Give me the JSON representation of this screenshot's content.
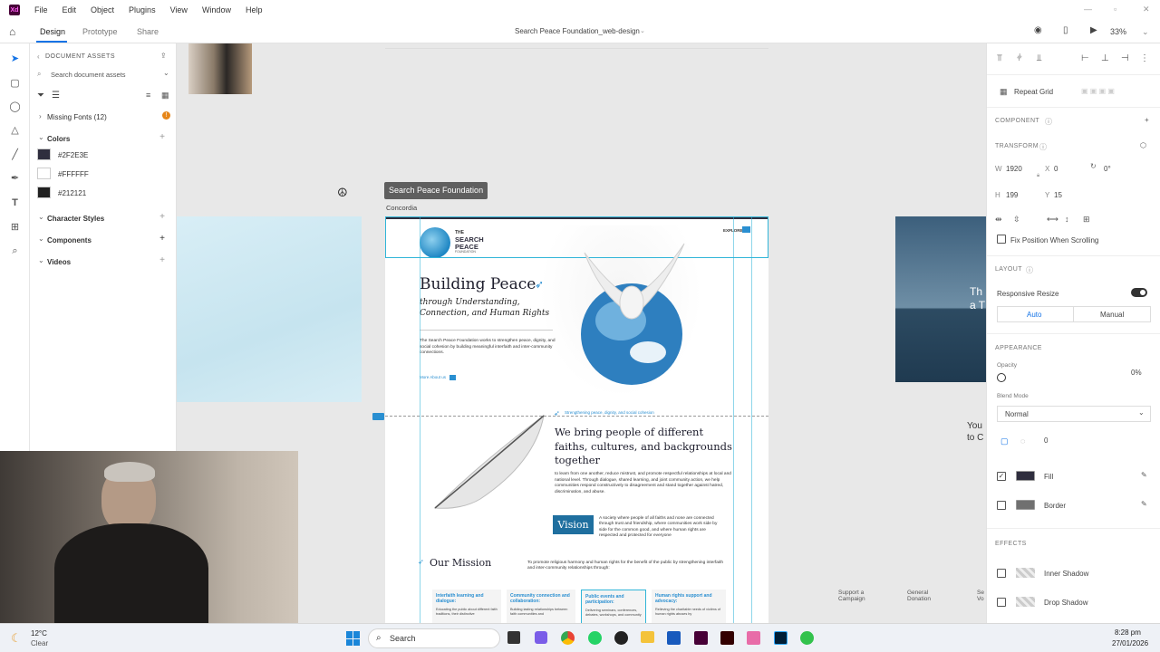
{
  "menubar": {
    "items": [
      "File",
      "Edit",
      "Object",
      "Plugins",
      "View",
      "Window",
      "Help"
    ]
  },
  "tabbar": {
    "tabs": [
      "Design",
      "Prototype",
      "Share"
    ],
    "doc_title": "Search Peace Foundation_web-design",
    "zoom": "33%"
  },
  "assets": {
    "header": "DOCUMENT ASSETS",
    "search_placeholder": "Search document assets",
    "missing_fonts": "Missing Fonts (12)",
    "colors_header": "Colors",
    "colors": [
      {
        "hex": "#2F2E3E",
        "swatch": "#2F2E3E"
      },
      {
        "hex": "#FFFFFF",
        "swatch": "#FFFFFF"
      },
      {
        "hex": "#212121",
        "swatch": "#212121"
      }
    ],
    "character_styles": "Character Styles",
    "components": "Components",
    "videos": "Videos"
  },
  "canvas": {
    "artboard_label": "Search Peace Foundation",
    "font_label": "Concordia",
    "right_snippets": [
      "You",
      "to C"
    ],
    "bottom_snippets": [
      "Support a\nCampaign",
      "General\nDonation",
      "Se\nVo"
    ],
    "right_card_text": [
      "Th",
      "a T"
    ]
  },
  "artboard": {
    "logo_line1": "THE",
    "logo_line2": "SEARCH",
    "logo_line3": "PEACE",
    "logo_line4": "FOUNDATION",
    "explore": "EXPLORE",
    "hero_title": "Building Peace",
    "hero_subtitle": "through Understanding, Connection, and Human Rights",
    "hero_body": "The Search Peace Foundation works to strengthen peace, dignity, and social cohesion by building meaningful interfaith and inter-community connections.",
    "more_link": "More About us",
    "tagline": "Strengthening peace, dignity, and social cohesion",
    "bring_title": "We bring people of different faiths, cultures, and backgrounds together",
    "bring_body": "to learn from one another, reduce mistrust, and promote respectful relationships at local and national level. Through dialogue, shared learning, and joint community action, we help communities respond constructively to disagreement and stand together against hatred, discrimination, and abuse.",
    "vision_label": "Vision",
    "vision_body": "A society where people of all faiths and none are connected through trust and friendship, where communities work side by side for the common good, and where human rights are respected and protected for everyone",
    "mission_title": "Our Mission",
    "mission_body": "To promote religious harmony and human rights for the benefit of the public by strengthening interfaith and inter-community relationships through:",
    "cards": [
      {
        "title": "Interfaith learning and dialogue:",
        "body": "Educating the public about different faith traditions, their distinctive"
      },
      {
        "title": "Community connection and collaboration:",
        "body": "Building lasting relationships between faith communities and"
      },
      {
        "title": "Public events and participation:",
        "body": "Delivering seminars, conferences, debates, workshops, and community"
      },
      {
        "title": "Human rights support and advocacy:",
        "body": "Relieving the charitable needs of victims of human rights abuses by"
      }
    ]
  },
  "properties": {
    "repeat_grid": "Repeat Grid",
    "component": "COMPONENT",
    "transform": "TRANSFORM",
    "w_label": "W",
    "w": "1920",
    "x_label": "X",
    "x": "0",
    "rotation": "0°",
    "h_label": "H",
    "h": "199",
    "y_label": "Y",
    "y": "15",
    "fix_position": "Fix Position When Scrolling",
    "layout": "LAYOUT",
    "responsive_resize": "Responsive Resize",
    "auto": "Auto",
    "manual": "Manual",
    "appearance": "APPEARANCE",
    "opacity_label": "Opacity",
    "opacity": "0%",
    "blend_label": "Blend Mode",
    "blend": "Normal",
    "corner": "0",
    "fill": "Fill",
    "fill_color": "#2F2E3E",
    "border": "Border",
    "effects": "EFFECTS",
    "inner_shadow": "Inner Shadow",
    "drop_shadow": "Drop Shadow"
  },
  "taskbar": {
    "temp": "12°C",
    "weather": "Clear",
    "search": "Search",
    "time": "8:28 pm",
    "date": "27/01/2026"
  }
}
